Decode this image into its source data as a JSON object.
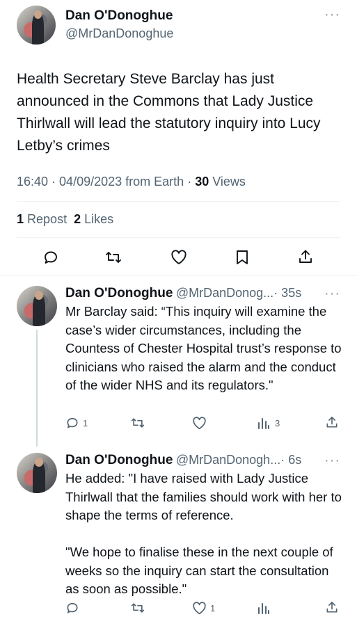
{
  "main_tweet": {
    "author_name": "Dan O'Donoghue",
    "author_handle": "@MrDanDonoghue",
    "more": "···",
    "text": "Health Secretary Steve Barclay has just announced in the Commons that Lady Justice Thirlwall will lead the statutory inquiry into Lucy Letby’s crimes",
    "time": "16:40",
    "date": "04/09/2023",
    "source": "from Earth",
    "views_count": "30",
    "views_label": "Views",
    "reposts_count": "1",
    "reposts_label": "Repost",
    "likes_count": "2",
    "likes_label": "Likes"
  },
  "replies": [
    {
      "author_name": "Dan O'Donoghue",
      "author_handle": "@MrDanDonog...",
      "time": "· 35s",
      "more": "···",
      "text": "Mr Barclay said: “This inquiry will examine the case’s wider circumstances, including the Countess of Chester Hospital trust’s response to clinicians who raised the alarm and the conduct of the wider NHS and its regulators.\"",
      "reply_count": "1",
      "repost_count": "",
      "like_count": "",
      "views_count": "3"
    },
    {
      "author_name": "Dan O'Donoghue",
      "author_handle": "@MrDanDonogh...",
      "time": "· 6s",
      "more": "···",
      "text": "He added: \"I have raised with Lady Justice Thirlwall that the families should work with her to shape the terms of reference.\n\n\"We hope to finalise these in the next couple of weeks so the inquiry can start the consultation as soon as possible.\"",
      "reply_count": "",
      "repost_count": "",
      "like_count": "1",
      "views_count": ""
    }
  ],
  "icons": {
    "reply": "reply-icon",
    "repost": "repost-icon",
    "like": "heart-icon",
    "bookmark": "bookmark-icon",
    "share": "share-icon",
    "views": "views-icon"
  },
  "colors": {
    "text": "#0f1419",
    "secondary": "#536471",
    "divider": "#eff3f4",
    "thread_line": "#cfd9de"
  }
}
